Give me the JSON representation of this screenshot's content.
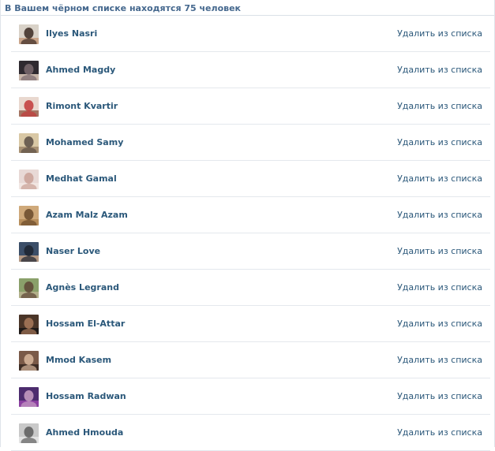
{
  "blacklist": {
    "summary": "В Вашем чёрном списке находятся 75 человек",
    "remove_label": "Удалить из списка",
    "users": [
      {
        "name": "Ilyes Nasri",
        "avatar": "ilyes-nasri-avatar",
        "colors": [
          "#d9d2c8",
          "#3a2a22",
          "#c9a58a"
        ]
      },
      {
        "name": "Ahmed Magdy",
        "avatar": "ahmed-magdy-avatar",
        "colors": [
          "#2f2a30",
          "#7a6a6f",
          "#c7b5a8"
        ]
      },
      {
        "name": "Rimont Kvartir",
        "avatar": "rimont-kvartir-avatar",
        "colors": [
          "#e9d8cf",
          "#c23a3a",
          "#a57462"
        ]
      },
      {
        "name": "Mohamed Samy",
        "avatar": "mohamed-samy-avatar",
        "colors": [
          "#d9c8a5",
          "#5b4f45",
          "#a89174"
        ]
      },
      {
        "name": "Medhat Gamal",
        "avatar": "medhat-gamal-avatar",
        "colors": [
          "#e8d9d6",
          "#c9a096",
          "#f1e6e2"
        ]
      },
      {
        "name": "Azam Malz Azam",
        "avatar": "azam-malz-azam-avatar",
        "colors": [
          "#cfa97a",
          "#6a4a2a",
          "#b78e5c"
        ]
      },
      {
        "name": "Naser Love",
        "avatar": "naser-love-avatar",
        "colors": [
          "#3b4e68",
          "#1d2430",
          "#b39883"
        ]
      },
      {
        "name": "Agnès Legrand",
        "avatar": "agnes-legrand-avatar",
        "colors": [
          "#8aa06a",
          "#5d4535",
          "#b2b08a"
        ]
      },
      {
        "name": "Hossam El-Attar",
        "avatar": "hossam-el-attar-avatar",
        "colors": [
          "#4a3528",
          "#a8795a",
          "#1f1a18"
        ]
      },
      {
        "name": "Mmod Kasem",
        "avatar": "mmod-kasem-avatar",
        "colors": [
          "#7a5a48",
          "#d9b89d",
          "#3e2d25"
        ]
      },
      {
        "name": "Hossam Radwan",
        "avatar": "hossam-radwan-avatar",
        "colors": [
          "#4c2c6e",
          "#c9a0c4",
          "#8a3fa0"
        ]
      },
      {
        "name": "Ahmed Hmouda",
        "avatar": "ahmed-hmouda-avatar",
        "colors": [
          "#c9c9c9",
          "#5c5c5c",
          "#e3e3e3"
        ]
      }
    ]
  },
  "colors": {
    "link": "#2b587a",
    "summary_text": "#45688e",
    "divider": "#e4e8ed"
  }
}
